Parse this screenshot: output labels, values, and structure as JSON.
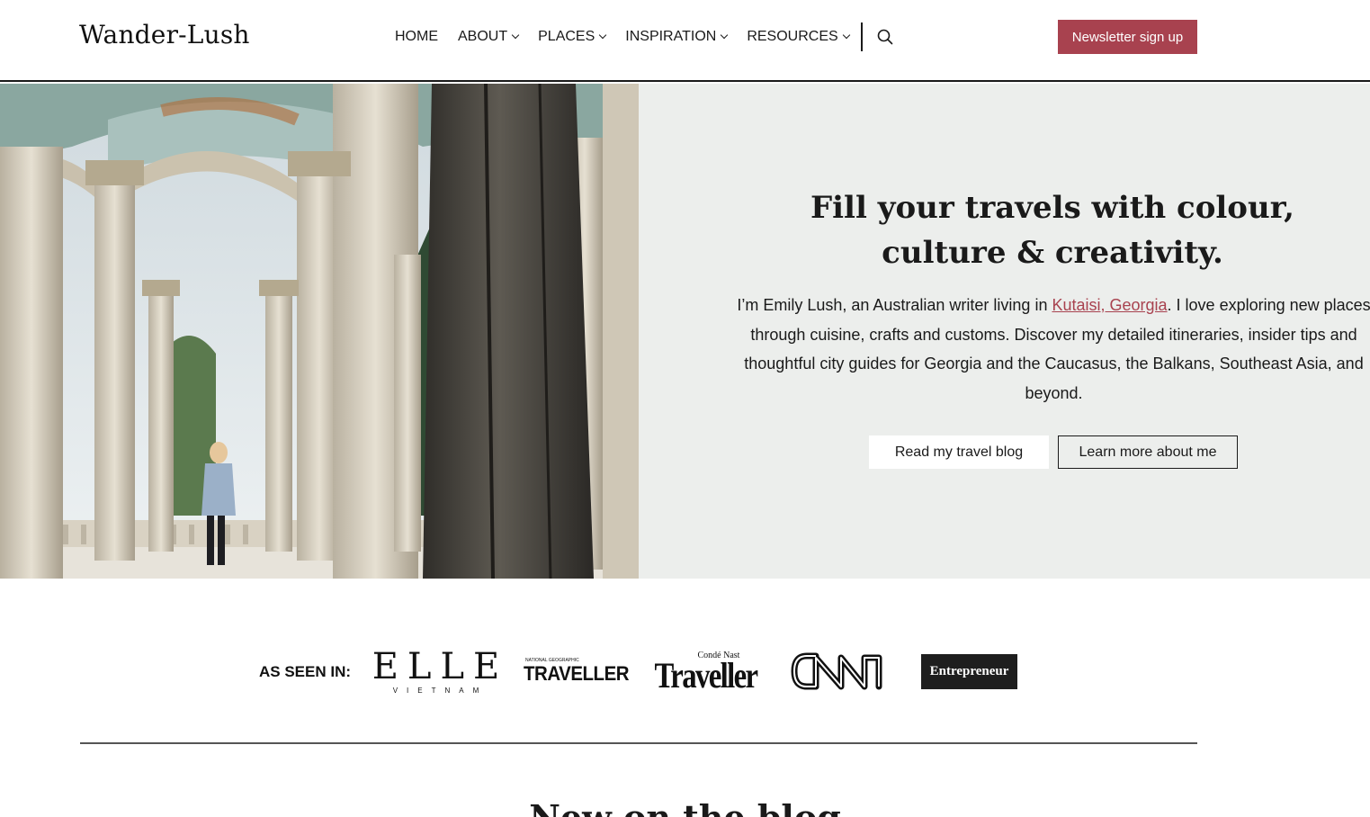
{
  "site": {
    "name": "Wander-Lush"
  },
  "nav": {
    "items": [
      {
        "label": "HOME",
        "dropdown": false
      },
      {
        "label": "ABOUT",
        "dropdown": true
      },
      {
        "label": "PLACES",
        "dropdown": true
      },
      {
        "label": "INSPIRATION",
        "dropdown": true
      },
      {
        "label": "RESOURCES",
        "dropdown": true
      }
    ],
    "search_icon": "search-icon",
    "newsletter_label": "Newsletter sign up"
  },
  "hero": {
    "title": "Fill your travels with colour, culture & creativity.",
    "intro_before_link": "I’m Emily Lush, an Australian writer living in ",
    "intro_link": "Kutaisi, Georgia",
    "intro_after_link": ". I love exploring new places through cuisine, crafts and customs. Discover my detailed itineraries, insider tips and thoughtful city guides for Georgia and the Caucasus, the Balkans, Southeast Asia, and beyond.",
    "primary_button": "Read my travel blog",
    "secondary_button": "Learn more about me"
  },
  "press": {
    "label": "AS SEEN IN:",
    "logos": {
      "elle_main": "ELLE",
      "elle_sub": "VIETNAM",
      "natgeo_small": "NATIONAL GEOGRAPHIC",
      "natgeo_main": "TRAVELLER",
      "conde_small": "Condé Nast",
      "conde_main": "Traveller",
      "cnn": "CNN",
      "entrepreneur": "Entrepreneur"
    }
  },
  "blog": {
    "heading": "New on the blog"
  },
  "colors": {
    "accent": "#a8424f",
    "hero_panel": "#eceeec",
    "text": "#1a1a1a"
  }
}
